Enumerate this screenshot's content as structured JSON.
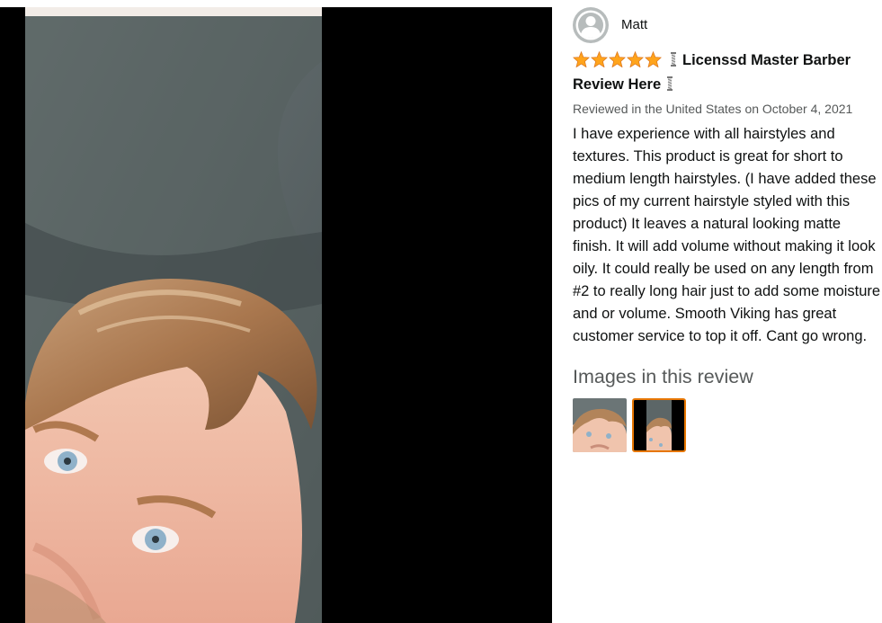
{
  "viewer": {
    "photo_icon": "review-photo"
  },
  "review": {
    "profile_name": "Matt",
    "avatar_icon": "default-user-avatar-icon",
    "rating": 5,
    "rating_max": 5,
    "title_line1": "Licenssd Master Barber",
    "title_line2": "Review Here",
    "title_icon": "barber-pole-icon",
    "date": "Reviewed in the United States on October 4, 2021",
    "body": "I have experience with all hairstyles and textures. This product is great for short to medium length hairstyles. (I have added these pics of my current hairstyle styled with this product) It leaves a natural looking matte finish. It will add volume without making it look oily. It could really be used on any length from #2 to really long hair just to add some moisture and or volume. Smooth Viking has great customer service to top it off. Cant go wrong.",
    "images_heading": "Images in this review",
    "thumbnails": [
      {
        "name": "thumbnail-1",
        "selected": false
      },
      {
        "name": "thumbnail-2",
        "selected": true
      }
    ]
  },
  "colors": {
    "viewer_bg": "#000000",
    "star": "#ffa41c",
    "selected_border": "#e77600",
    "muted_text": "#565959"
  }
}
